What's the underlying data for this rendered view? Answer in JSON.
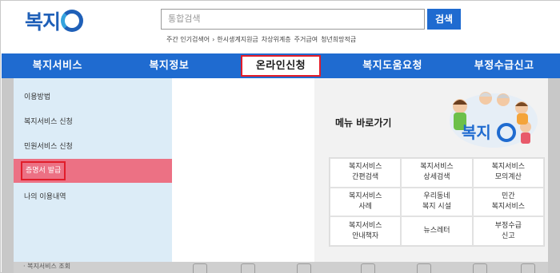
{
  "header": {
    "logo_text": "복지",
    "search_placeholder": "통합검색",
    "search_button": "검색",
    "popular": {
      "title": "주간 인기검색어",
      "keywords": [
        "한시생계지원금",
        "차상위계층",
        "주거급여",
        "청년희망적금"
      ]
    }
  },
  "nav": {
    "items": [
      {
        "label": "복지서비스"
      },
      {
        "label": "복지정보"
      },
      {
        "label": "온라인신청"
      },
      {
        "label": "복지도움요청"
      },
      {
        "label": "부정수급신고"
      }
    ]
  },
  "submenu": {
    "items": [
      {
        "label": "이용방법"
      },
      {
        "label": "복지서비스 신청"
      },
      {
        "label": "민원서비스 신청"
      },
      {
        "label": "증명서 발급"
      },
      {
        "label": "나의 이용내역"
      }
    ]
  },
  "shortcut": {
    "title": "메뉴 바로가기",
    "mascot_logo": "복지",
    "cells": [
      {
        "line1": "복지서비스",
        "line2": "간편검색"
      },
      {
        "line1": "복지서비스",
        "line2": "상세검색"
      },
      {
        "line1": "복지서비스",
        "line2": "모의계산"
      },
      {
        "line1": "복지서비스",
        "line2": "사례"
      },
      {
        "line1": "우리동네",
        "line2": "복지 시설"
      },
      {
        "line1": "민간",
        "line2": "복지서비스"
      },
      {
        "line1": "복지서비스",
        "line2": "안내책자"
      },
      {
        "line1": "뉴스레터",
        "line2": ""
      },
      {
        "line1": "부정수급",
        "line2": "신고"
      }
    ]
  },
  "bottom": {
    "text": "· 복지서비스 조회"
  },
  "colors": {
    "brand": "#1f6bd0",
    "highlight": "#e11d2a",
    "selected": "#ec7184"
  }
}
